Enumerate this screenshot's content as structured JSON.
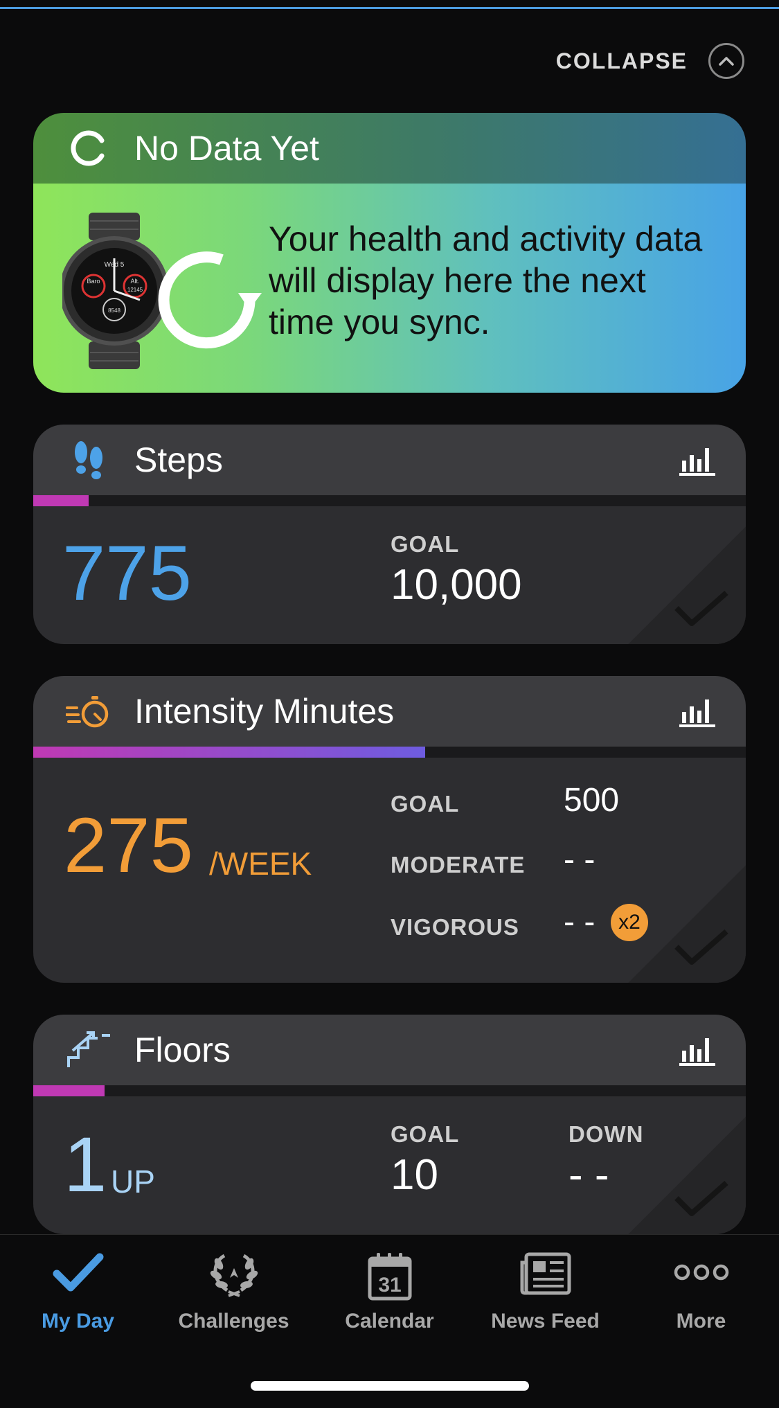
{
  "collapse": {
    "label": "COLLAPSE"
  },
  "no_data": {
    "title": "No Data Yet",
    "message": "Your health and activity data will display here the next time you sync."
  },
  "steps": {
    "title": "Steps",
    "value": "775",
    "goal_label": "GOAL",
    "goal_value": "10,000",
    "progress": 0.0775
  },
  "intensity": {
    "title": "Intensity Minutes",
    "value": "275",
    "unit": "/WEEK",
    "goal_label": "GOAL",
    "goal_value": "500",
    "moderate_label": "MODERATE",
    "moderate_value": "- -",
    "vigorous_label": "VIGOROUS",
    "vigorous_value": "- -",
    "vigorous_badge": "x2",
    "progress": 0.55
  },
  "floors": {
    "title": "Floors",
    "value": "1",
    "unit": "UP",
    "goal_label": "GOAL",
    "goal_value": "10",
    "down_label": "DOWN",
    "down_value": "- -",
    "progress": 0.1
  },
  "nav": {
    "items": [
      {
        "label": "My Day",
        "icon": "checkmark-icon",
        "active": true
      },
      {
        "label": "Challenges",
        "icon": "laurel-icon",
        "active": false
      },
      {
        "label": "Calendar",
        "icon": "calendar-icon",
        "calendar_day": "31",
        "active": false
      },
      {
        "label": "News Feed",
        "icon": "newspaper-icon",
        "active": false
      },
      {
        "label": "More",
        "icon": "more-dots-icon",
        "active": false
      }
    ]
  },
  "watch": {
    "face_day": "Wed 5",
    "face_left": "Baro",
    "face_right": "Alt.",
    "face_right_value": "12145",
    "face_bottom": "8548"
  },
  "colors": {
    "accent_blue": "#4a9be2",
    "steps_blue": "#4da2e8",
    "intensity_orange": "#f29d38",
    "floors_lightblue": "#a9d3f5",
    "progress_magenta": "#c039b4",
    "progress_purple": "#6e5ce0"
  }
}
